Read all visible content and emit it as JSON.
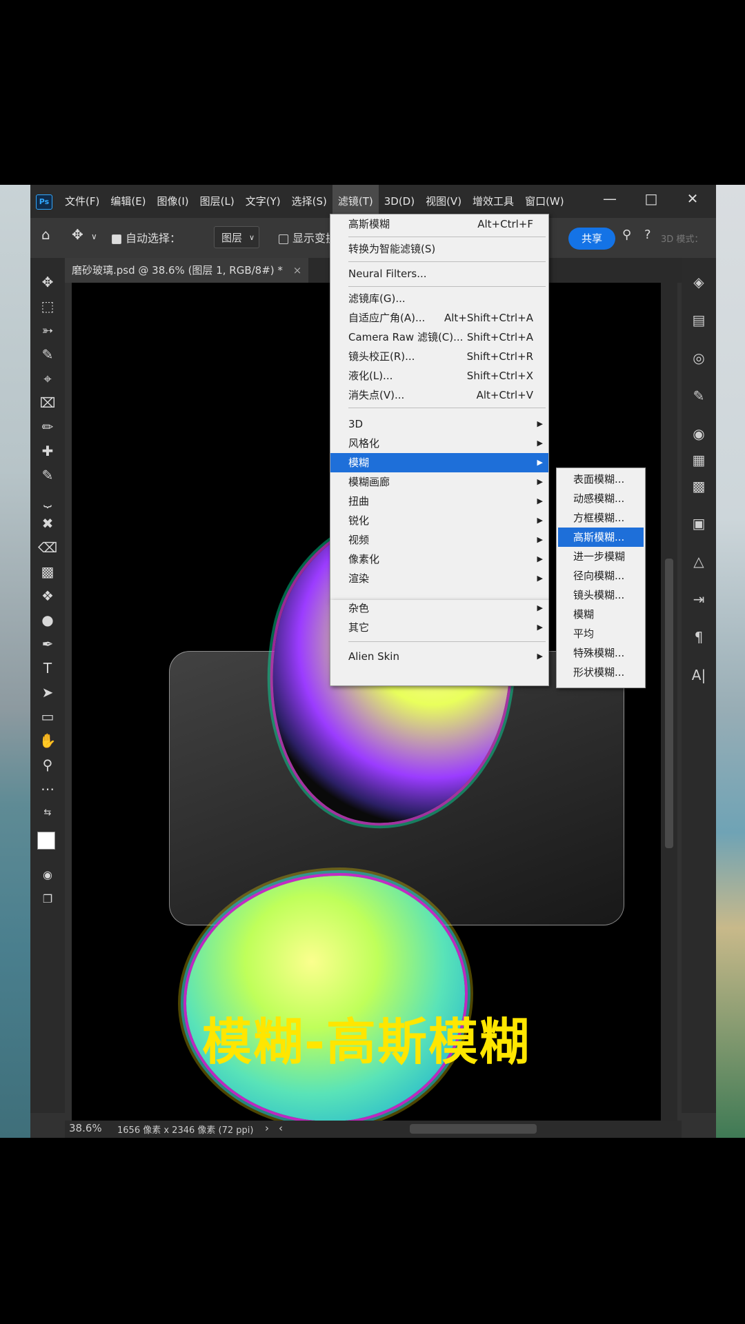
{
  "window": {
    "menus": [
      "文件(F)",
      "编辑(E)",
      "图像(I)",
      "图层(L)",
      "文字(Y)",
      "选择(S)",
      "滤镜(T)",
      "3D(D)",
      "视图(V)",
      "增效工具",
      "窗口(W)"
    ],
    "active_menu": "滤镜(T)"
  },
  "options_bar": {
    "auto_select_label": "自动选择：",
    "layer_select_value": "图层",
    "show_transform_label": "显示变换",
    "share_label": "共享",
    "mode_3d_label": "3D 模式："
  },
  "document": {
    "tab_title": "磨砂玻璃.psd @ 38.6% (图层 1, RGB/8#) *",
    "zoom": "38.6%",
    "dimensions": "1656 像素 x 2346 像素 (72 ppi)"
  },
  "caption": "模糊-高斯模糊",
  "filter_menu": {
    "items": [
      {
        "label": "高斯模糊",
        "shortcut": "Alt+Ctrl+F"
      },
      {
        "label": "转换为智能滤镜(S)",
        "shortcut": ""
      },
      {
        "label": "Neural Filters...",
        "shortcut": ""
      },
      {
        "label": "滤镜库(G)...",
        "shortcut": ""
      },
      {
        "label": "自适应广角(A)...",
        "shortcut": "Alt+Shift+Ctrl+A"
      },
      {
        "label": "Camera Raw 滤镜(C)...",
        "shortcut": "Shift+Ctrl+A"
      },
      {
        "label": "镜头校正(R)...",
        "shortcut": "Shift+Ctrl+R"
      },
      {
        "label": "液化(L)...",
        "shortcut": "Shift+Ctrl+X"
      },
      {
        "label": "消失点(V)...",
        "shortcut": "Alt+Ctrl+V"
      },
      {
        "label": "3D",
        "shortcut": ""
      },
      {
        "label": "风格化",
        "shortcut": ""
      },
      {
        "label": "模糊",
        "shortcut": ""
      },
      {
        "label": "模糊画廊",
        "shortcut": ""
      },
      {
        "label": "扭曲",
        "shortcut": ""
      },
      {
        "label": "锐化",
        "shortcut": ""
      },
      {
        "label": "视频",
        "shortcut": ""
      },
      {
        "label": "像素化",
        "shortcut": ""
      },
      {
        "label": "渲染",
        "shortcut": ""
      },
      {
        "label": "杂色",
        "shortcut": ""
      },
      {
        "label": "其它",
        "shortcut": ""
      },
      {
        "label": "Alien Skin",
        "shortcut": ""
      }
    ],
    "highlighted": "模糊"
  },
  "blur_submenu": {
    "items": [
      "表面模糊...",
      "动感模糊...",
      "方框模糊...",
      "高斯模糊...",
      "进一步模糊",
      "径向模糊...",
      "镜头模糊...",
      "模糊",
      "平均",
      "特殊模糊...",
      "形状模糊..."
    ],
    "highlighted": "高斯模糊..."
  },
  "colors": {
    "accent": "#1e6fd9",
    "share": "#1473e6",
    "caption": "#ffe600"
  }
}
